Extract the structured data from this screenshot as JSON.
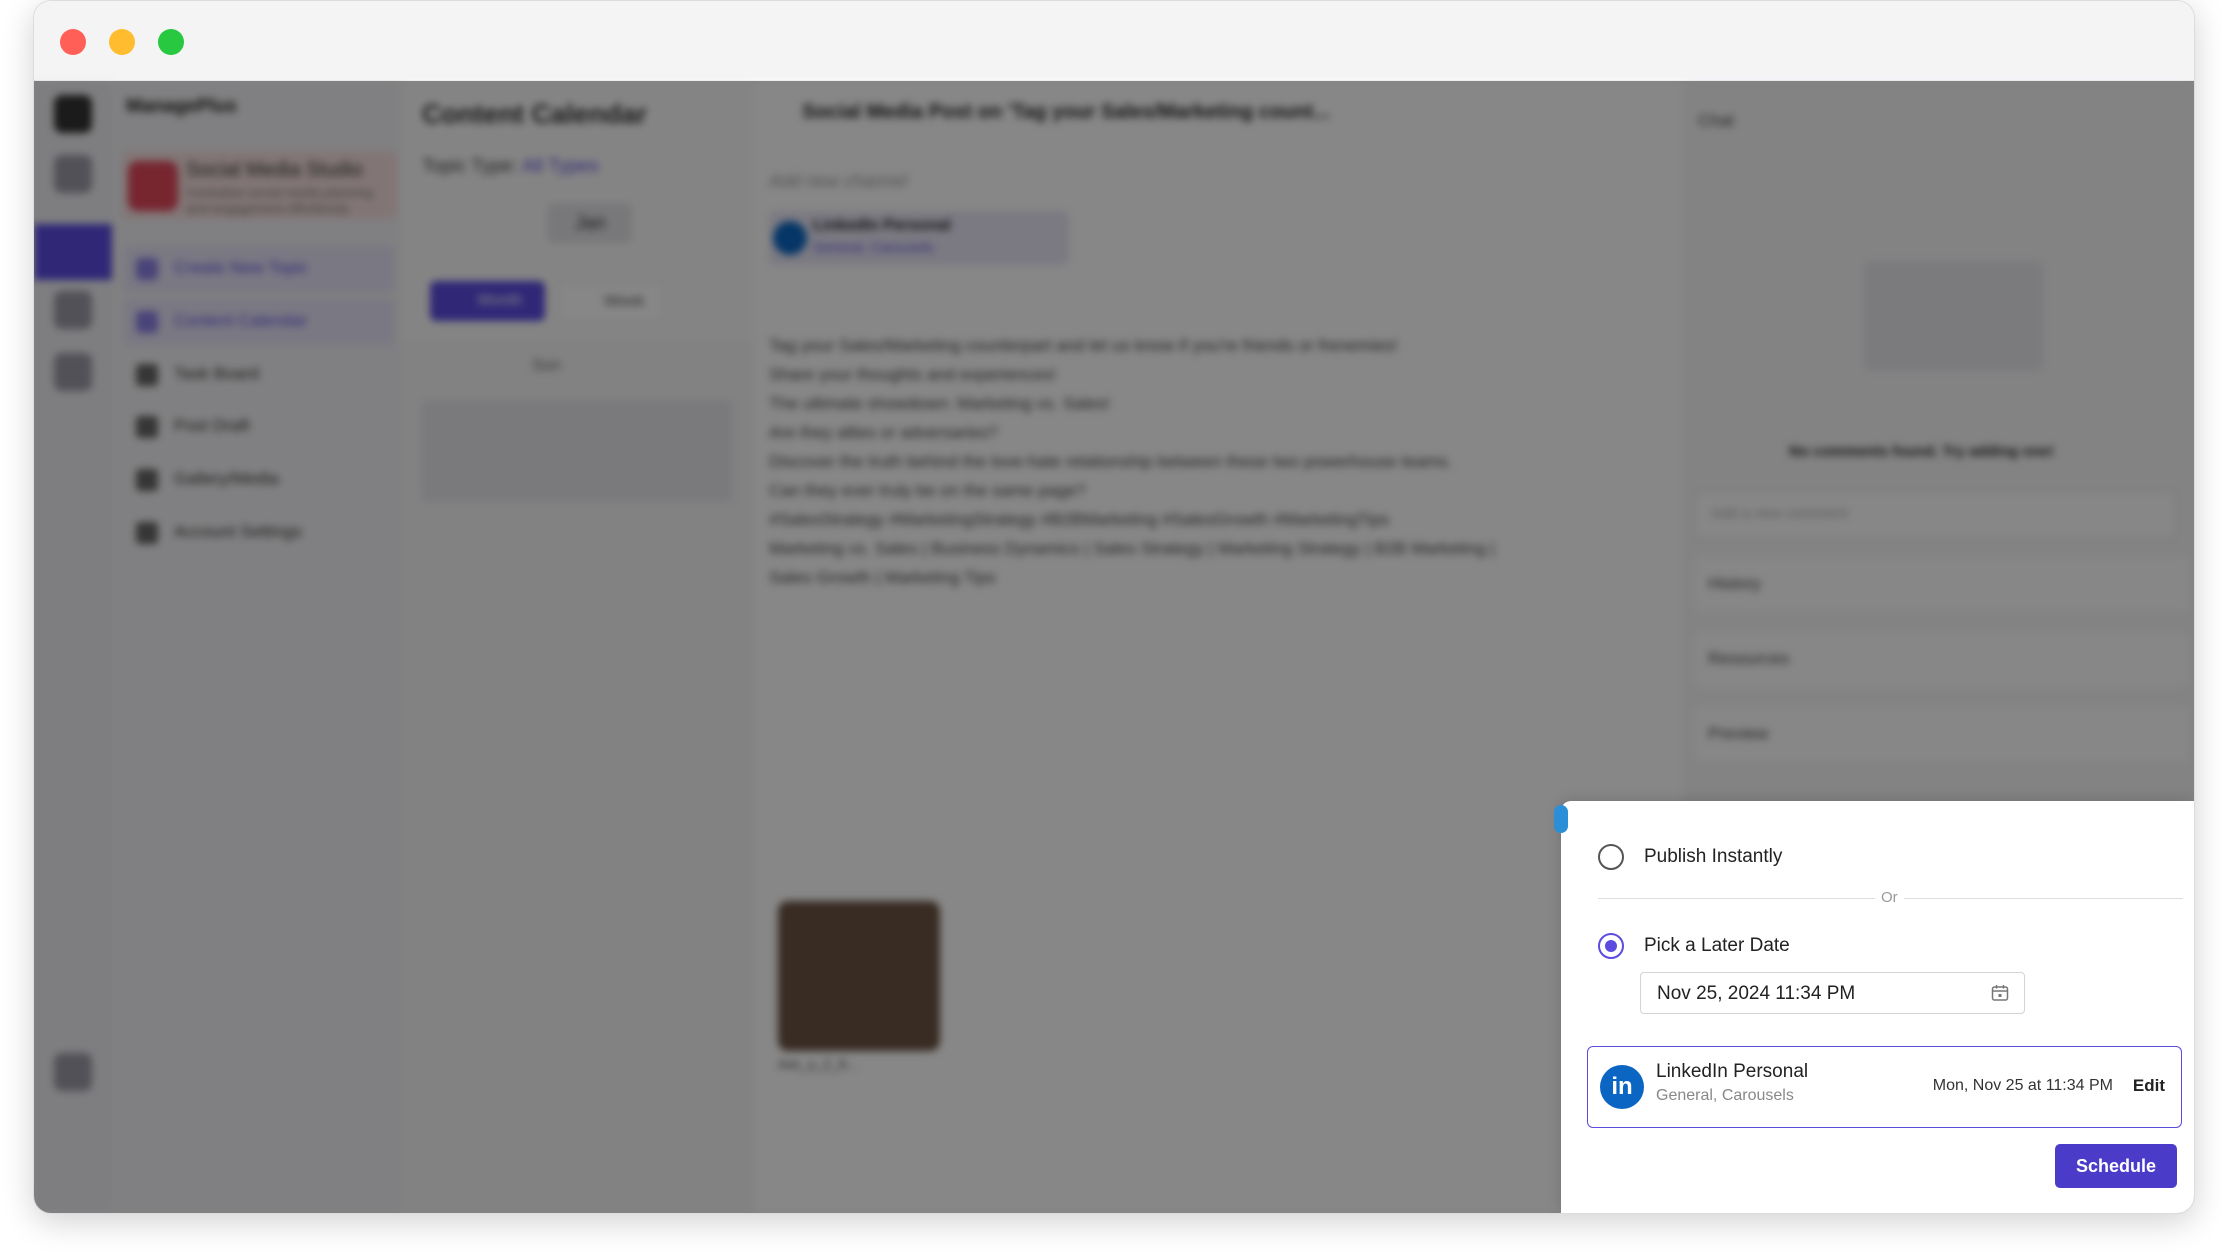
{
  "window": {
    "controls": [
      "close",
      "minimize",
      "maximize"
    ]
  },
  "background": {
    "workspace_name": "ManagePlus",
    "studio_title": "Social Media Studio",
    "studio_subtitle": "Centralize social media planning and engagement effortlessly",
    "nav_items": [
      {
        "label": "Create New Topic",
        "icon": "plus-list-icon"
      },
      {
        "label": "Content Calendar",
        "icon": "calendar-icon"
      },
      {
        "label": "Task Board",
        "icon": "board-icon"
      },
      {
        "label": "Post Draft",
        "icon": "draft-icon"
      },
      {
        "label": "Gallery/Media",
        "icon": "gallery-icon"
      },
      {
        "label": "Account Settings",
        "icon": "settings-icon"
      }
    ],
    "calendar_title": "Content Calendar",
    "topic_type_label": "Topic Type:",
    "topic_type_value": "All Types",
    "month_label": "Jan",
    "view_month": "Month",
    "view_week": "Week",
    "day_header": "Sun",
    "modal_title": "Social Media Post on 'Tag your Sales/Marketing count...",
    "add_channel": "Add new channel",
    "channel_chip_name": "LinkedIn Personal",
    "channel_chip_sub": "General, Carousels",
    "post_lines": [
      "Tag your Sales/Marketing counterpart and let us know if you're friends or frenemies!",
      "Share your thoughts and experiences!",
      "The ultimate showdown: Marketing vs. Sales!",
      "Are they allies or adversaries?",
      "Discover the truth behind the love-hate relationship between these two powerhouse teams.",
      "Can they ever truly be on the same page?",
      "#SalesStrategy #MarketingStrategy #B2BMarketing #SalesGrowth #MarketingTips",
      "Marketing vs. Sales | Business Dynamics | Sales Strategy | Marketing Strategy | B2B Marketing |",
      "Sales Growth | Marketing Tips"
    ],
    "attachment_name": "Are_u_2_fr...",
    "chat_title": "Chat",
    "no_comments": "No comments found. Try adding one!",
    "comment_placeholder": "Add a new comment",
    "panels": [
      "History",
      "Resources",
      "Preview"
    ]
  },
  "popover": {
    "publish_instantly": "Publish Instantly",
    "or_text": "Or",
    "pick_later": "Pick a Later Date",
    "selected_option": "pick_later",
    "date_value": "Nov 25, 2024 11:34 PM",
    "channel": {
      "name": "LinkedIn Personal",
      "sub": "General, Carousels",
      "time": "Mon, Nov 25 at 11:34 PM",
      "edit": "Edit",
      "logo_text": "in"
    },
    "schedule_label": "Schedule"
  },
  "colors": {
    "accent": "#4b3bc9",
    "linkedin": "#0a66c2",
    "overlay": "rgba(0,0,0,0.47)"
  }
}
